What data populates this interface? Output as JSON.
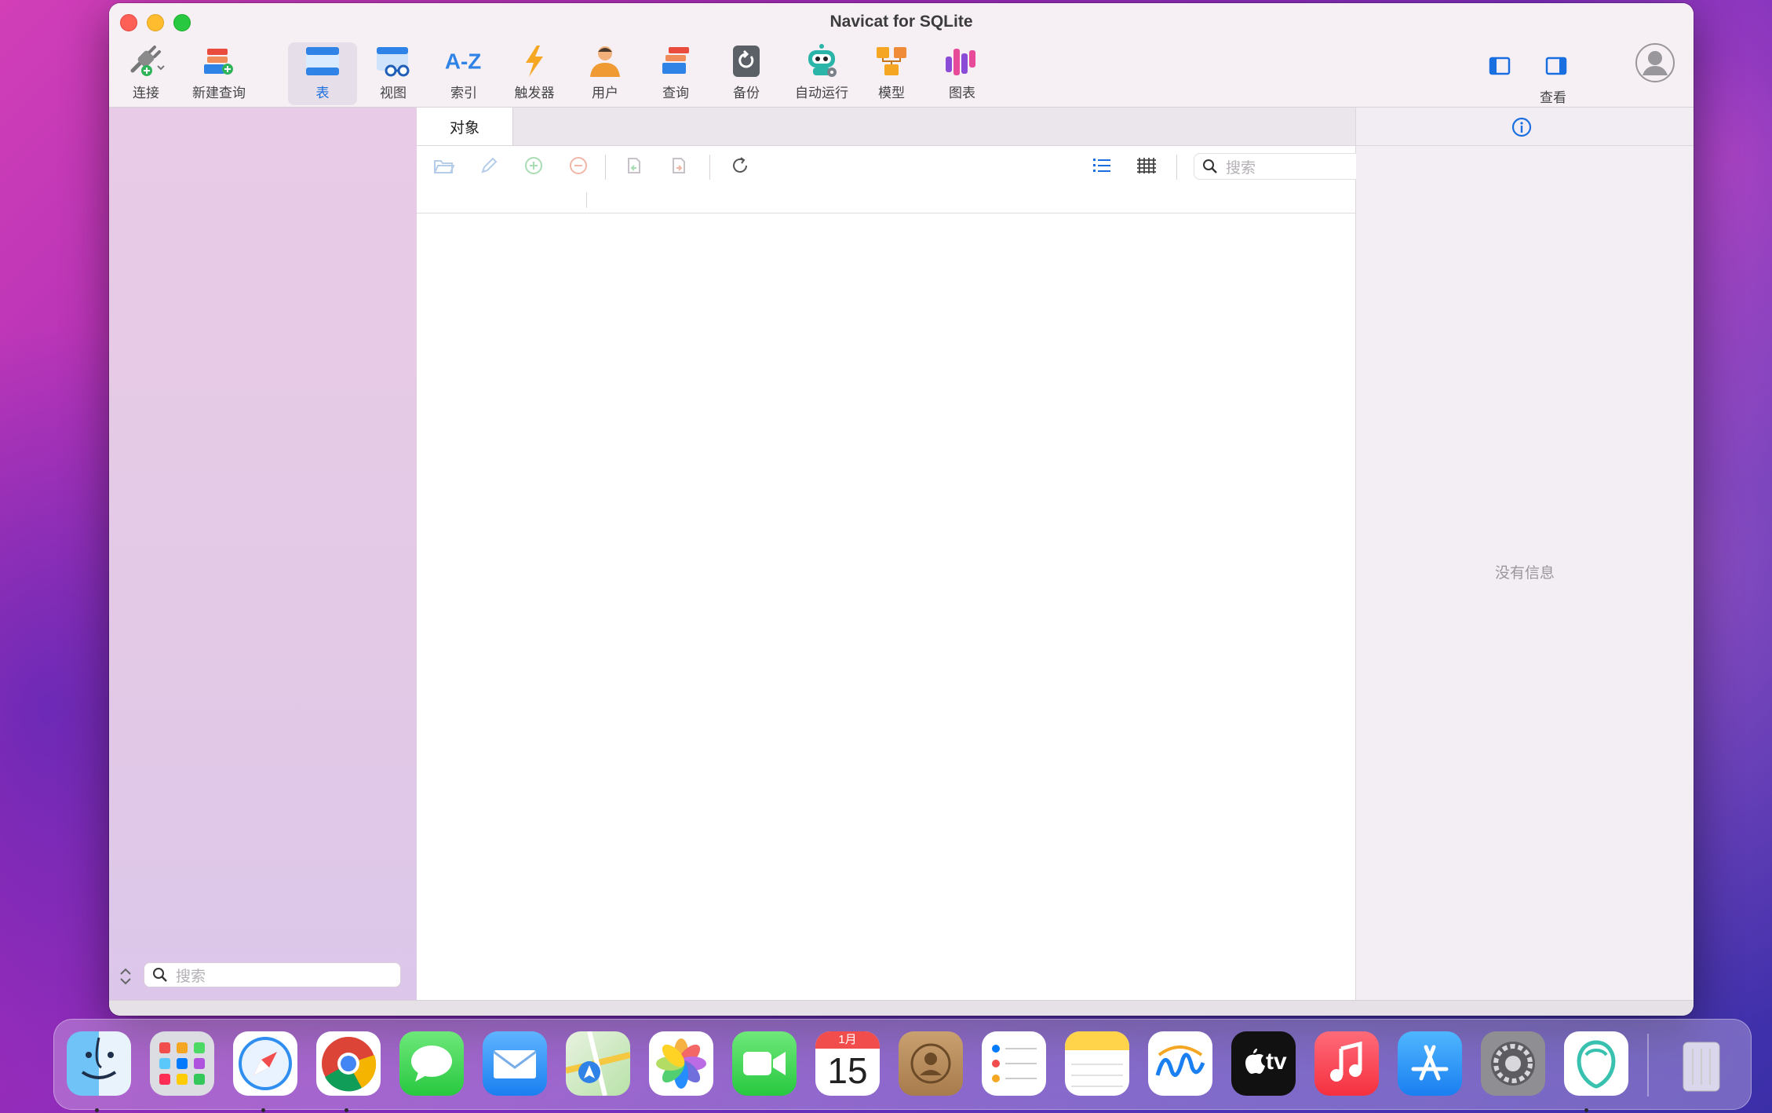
{
  "window": {
    "title": "Navicat for SQLite"
  },
  "toolbar": {
    "items": [
      {
        "label": "连接",
        "icon": "connection-plug-icon"
      },
      {
        "label": "新建查询",
        "icon": "new-query-icon"
      },
      {
        "label": "表",
        "icon": "table-icon",
        "active": true
      },
      {
        "label": "视图",
        "icon": "view-glasses-icon"
      },
      {
        "label": "索引",
        "icon": "index-az-icon"
      },
      {
        "label": "触发器",
        "icon": "trigger-bolt-icon"
      },
      {
        "label": "用户",
        "icon": "user-icon"
      },
      {
        "label": "查询",
        "icon": "query-icon"
      },
      {
        "label": "备份",
        "icon": "backup-icon"
      },
      {
        "label": "自动运行",
        "icon": "automation-robot-icon"
      },
      {
        "label": "模型",
        "icon": "model-icon"
      },
      {
        "label": "图表",
        "icon": "chart-icon"
      }
    ],
    "view_label": "查看"
  },
  "sidebar": {
    "search_placeholder": "搜索"
  },
  "main": {
    "tab_label": "对象",
    "search_placeholder": "搜索"
  },
  "info_panel": {
    "empty_text": "没有信息"
  },
  "dock": {
    "apps": [
      "Finder",
      "Launchpad",
      "Safari",
      "Chrome",
      "Messages",
      "Mail",
      "Maps",
      "Photos",
      "FaceTime",
      "Calendar",
      "Contacts",
      "Reminders",
      "Notes",
      "Freeform",
      "TV",
      "Music",
      "App Store",
      "System Settings",
      "Navicat",
      "Trash"
    ],
    "calendar_month": "1月",
    "calendar_day": "15",
    "tv_label": "tv"
  },
  "colors": {
    "accent": "#1a6fe0",
    "window_bg": "#f4f0f4",
    "sidebar_bg": "#e5cae6"
  }
}
